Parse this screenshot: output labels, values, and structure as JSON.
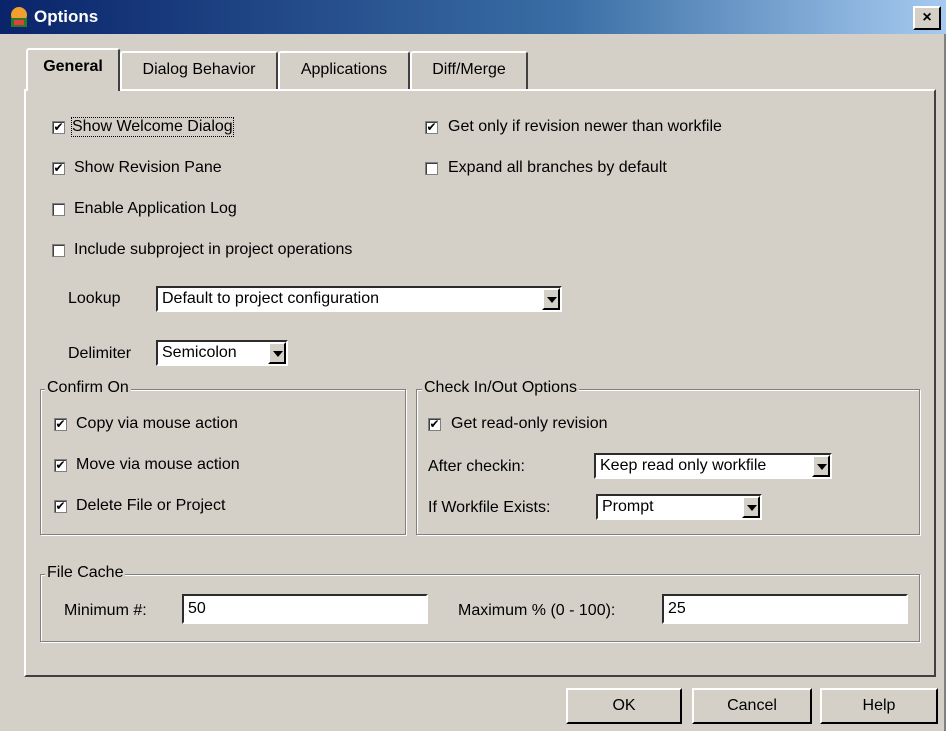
{
  "window": {
    "title": "Options",
    "close_glyph": "×"
  },
  "tabs": [
    {
      "label": "General",
      "active": true
    },
    {
      "label": "Dialog Behavior",
      "active": false
    },
    {
      "label": "Applications",
      "active": false
    },
    {
      "label": "Diff/Merge",
      "active": false
    }
  ],
  "general": {
    "show_welcome_dialog": {
      "label": "Show Welcome Dialog",
      "checked": true
    },
    "show_revision_pane": {
      "label": "Show Revision Pane",
      "checked": true
    },
    "enable_application_log": {
      "label": "Enable Application Log",
      "checked": false
    },
    "include_subproject": {
      "label": "Include subproject in project operations",
      "checked": false
    },
    "get_only_if_newer": {
      "label": "Get only if revision newer than workfile",
      "checked": true
    },
    "expand_all_branches": {
      "label": "Expand all branches by default",
      "checked": false
    },
    "lookup": {
      "label": "Lookup",
      "value": "Default to project configuration"
    },
    "delimiter": {
      "label": "Delimiter",
      "value": "Semicolon"
    }
  },
  "confirm_on": {
    "title": "Confirm On",
    "copy": {
      "label": "Copy via mouse action",
      "checked": true
    },
    "move": {
      "label": "Move via mouse action",
      "checked": true
    },
    "delete": {
      "label": "Delete File or Project",
      "checked": true
    }
  },
  "checkinout": {
    "title": "Check In/Out Options",
    "get_readonly": {
      "label": "Get read-only revision",
      "checked": true
    },
    "after_checkin": {
      "label": "After checkin:",
      "value": "Keep read only workfile"
    },
    "if_workfile_exists": {
      "label": "If Workfile Exists:",
      "value": "Prompt"
    }
  },
  "file_cache": {
    "title": "File Cache",
    "minimum": {
      "label": "Minimum #:",
      "value": "50"
    },
    "maximum": {
      "label": "Maximum % (0 - 100):",
      "value": "25"
    }
  },
  "buttons": {
    "ok": "OK",
    "cancel": "Cancel",
    "help": "Help"
  },
  "check_glyph": "✔"
}
